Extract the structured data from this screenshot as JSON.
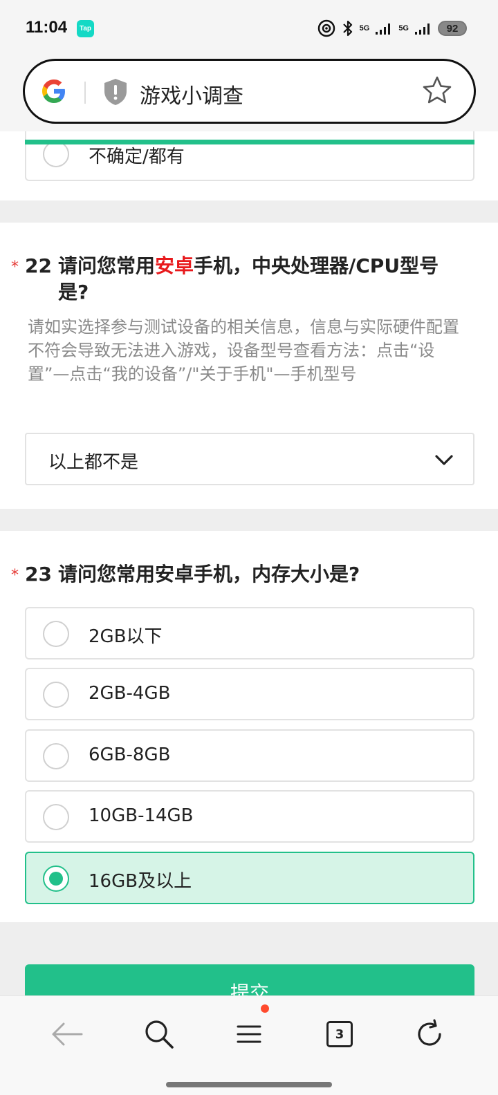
{
  "status_bar": {
    "time": "11:04",
    "app_badge": "Tap",
    "signal1": "5G",
    "signal2": "5G",
    "battery": "92"
  },
  "url_bar": {
    "title": "游戏小调查"
  },
  "previous_option": {
    "label": "不确定/都有"
  },
  "q22": {
    "required_mark": "*",
    "number": "22",
    "title_part1": "请问您常用",
    "title_highlight": "安卓",
    "title_part2": "手机，中央处理器/CPU型号是?",
    "description": "请如实选择参与测试设备的相关信息，信息与实际硬件配置不符会导致无法进入游戏，设备型号查看方法：点击“设置”—点击“我的设备”/\"关于手机\"—手机型号",
    "selected_value": "以上都不是"
  },
  "q23": {
    "required_mark": "*",
    "number": "23",
    "title": "请问您常用安卓手机，内存大小是?",
    "options": [
      "2GB以下",
      "2GB-4GB",
      "6GB-8GB",
      "10GB-14GB",
      "16GB及以上"
    ],
    "selected": "16GB及以上"
  },
  "submit": {
    "label": "提交"
  },
  "bottom_nav": {
    "tabs_count": "3"
  },
  "colors": {
    "accent": "#22c08a",
    "highlight_red": "#e8191c",
    "selected_bg": "#d6f4e7"
  }
}
